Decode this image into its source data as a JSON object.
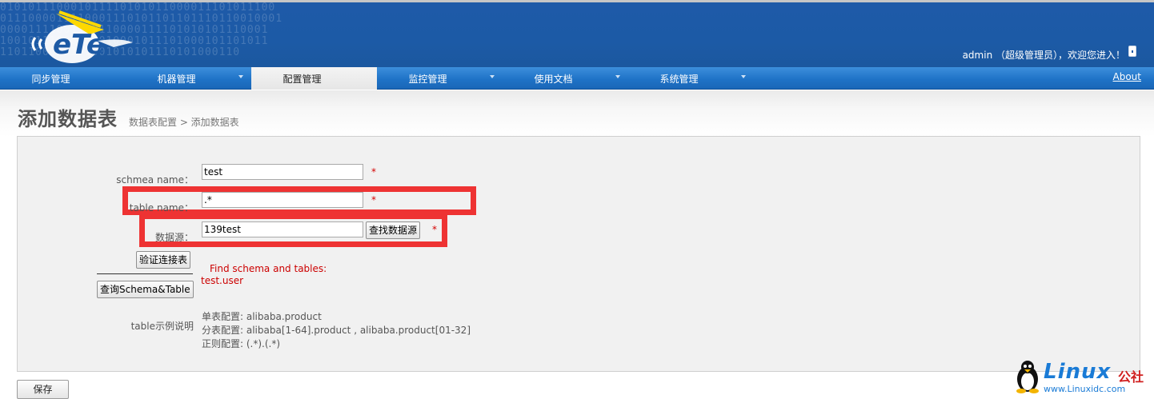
{
  "header": {
    "user_text": "admin （超级管理员），欢迎您进入！",
    "binary_bg": "010101110001011110101011000011101011100\n0111000011110001110101101101110110010001\n00001111001110110000111101010101110001\n10010111000101010001011101000101101011\n1101100010111001010101110101000110"
  },
  "nav": {
    "items": [
      {
        "label": "同步管理",
        "has_dropdown": false
      },
      {
        "label": "机器管理",
        "has_dropdown": true
      },
      {
        "label": "配置管理",
        "has_dropdown": false,
        "active": true
      },
      {
        "label": "监控管理",
        "has_dropdown": true
      },
      {
        "label": "使用文档",
        "has_dropdown": true
      },
      {
        "label": "系统管理",
        "has_dropdown": true
      }
    ],
    "about": "About"
  },
  "page": {
    "title": "添加数据表",
    "breadcrumb": "数据表配置 > 添加数据表"
  },
  "form": {
    "schema_label": "schmea name：",
    "schema_value": "test",
    "table_label": "table name：",
    "table_value": ".*",
    "datasource_label": "数据源：",
    "datasource_value": "139test",
    "find_datasource_button": "查找数据源",
    "required_mark": "*",
    "verify_button": "验证连接表",
    "query_button": "查询Schema&Table",
    "result_title": "Find schema and tables:",
    "result_value": "test.user",
    "example_label": "table示例说明",
    "example_lines": [
      "单表配置: alibaba.product",
      "分表配置: alibaba[1-64].product , alibaba.product[01-32]",
      "正则配置: (.*).(.*)"
    ]
  },
  "save_button": "保存",
  "watermark": {
    "main": "Linux",
    "cn": "公社",
    "sub": "www.Linuxidc.com"
  },
  "colors": {
    "header_bg": "#1c5aa6",
    "nav_bg": "#1f73c7",
    "highlight": "#ee3333",
    "required": "#d40000",
    "watermark": "#1a7bd6"
  }
}
